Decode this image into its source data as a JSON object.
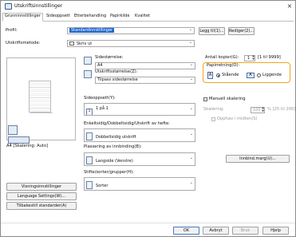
{
  "window": {
    "title": "Utskriftsinnstillinger",
    "close_glyph": "×"
  },
  "tabs": [
    {
      "label": "Grunninnstillinger"
    },
    {
      "label": "Sideoppsett"
    },
    {
      "label": "Etterbehandling"
    },
    {
      "label": "Papirkilde"
    },
    {
      "label": "Kvalitet"
    }
  ],
  "profile": {
    "label": "Profil:",
    "value": "Standardinnstillinger",
    "edit_label": "Legg til(1)...",
    "rename_label": "Rediger(2)..."
  },
  "output_method": {
    "label": "Utskriftsmetode:",
    "value": "Skriv ut"
  },
  "preview": {
    "caption": "A4 [Skalering: Auto]"
  },
  "page_size": {
    "label": "Sidestørrelse:",
    "value": "A4"
  },
  "output_size": {
    "label": "Utskriftsstørrelse(Z):",
    "value": "Tilpass sidestørrelse"
  },
  "copies": {
    "label": "Antall kopier(G):",
    "value": "1",
    "range": "[1 til 9999]"
  },
  "orientation": {
    "label": "Papirretning(O):",
    "portrait": "Stående",
    "landscape": "Liggende",
    "selected": "portrait"
  },
  "page_layout": {
    "label": "Sideoppsett(Y):",
    "value": "1 på 1"
  },
  "manual_scaling": {
    "label": "Manuell skalering",
    "scaling_label": "Skalering:",
    "value": "100",
    "unit": "% [25 til 200]",
    "center_label": "Opphav i midten(S)"
  },
  "duplex": {
    "label": "Enkeltsidig/Dobbeltsidig/Utskrift av hefte:",
    "value": "Dobbeltsidig utskrift"
  },
  "binding": {
    "label": "Plassering av innbinding(B):",
    "value": "Langside (Venstre)",
    "button": "Innbind.marg(U)..."
  },
  "staple": {
    "label": "Stifte/sorter/grupper(H):",
    "value": "Sorter"
  },
  "left_buttons": [
    "Visningsinnstillinger",
    "Language Settings(W)...",
    "Tilbakestill standarder(A)"
  ],
  "footer": {
    "ok": "OK",
    "cancel": "Avbryt",
    "apply": "Bruk",
    "help": "Hjelp"
  }
}
